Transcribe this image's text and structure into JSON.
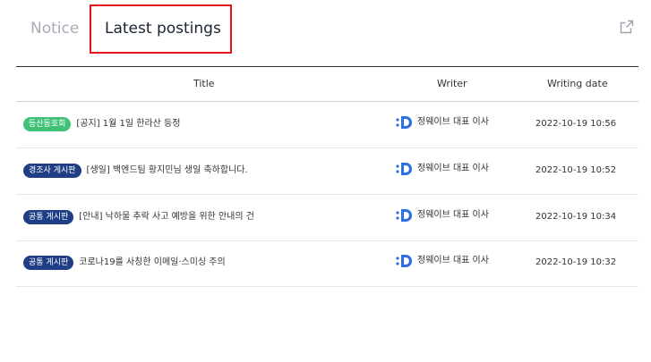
{
  "tabs": [
    {
      "label": "Notice",
      "active": false
    },
    {
      "label": "Latest postings",
      "active": true
    }
  ],
  "highlight_color": "#e8121f",
  "external_link_icon": "external-link-icon",
  "table": {
    "headers": {
      "title": "Title",
      "writer": "Writer",
      "date": "Writing date"
    },
    "rows": [
      {
        "badge": "등산동호회",
        "badge_color": "#3fc277",
        "title": "[공지] 1월 1일 한라산 등정",
        "writer": "정웨이브 대표 이사",
        "date": "2022-10-19 10:56"
      },
      {
        "badge": "경조사 게시판",
        "badge_color": "#1f3e85",
        "title": "[생일] 백엔드팀 황지민님 생일 축하합니다.",
        "writer": "정웨이브 대표 이사",
        "date": "2022-10-19 10:52"
      },
      {
        "badge": "공통 게시판",
        "badge_color": "#1f3e85",
        "title": "[안내] 낙하물 추락 사고 예방을 위한 안내의 건",
        "writer": "정웨이브 대표 이사",
        "date": "2022-10-19 10:34"
      },
      {
        "badge": "공통 게시판",
        "badge_color": "#1f3e85",
        "title": "코로나19를 사칭한 이메일·스미싱 주의",
        "writer": "정웨이브 대표 이사",
        "date": "2022-10-19 10:32"
      }
    ]
  },
  "writer_logo_icon": "company-logo-icon",
  "logo_color": "#2e6fe0"
}
